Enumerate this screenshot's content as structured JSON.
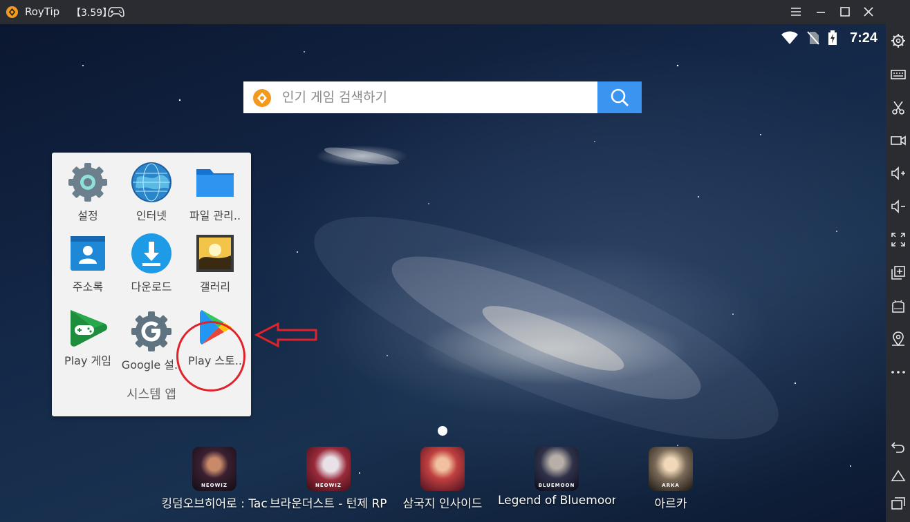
{
  "window": {
    "title": "RoyTip",
    "version": "【3.59】",
    "buttons": [
      "menu-icon",
      "minimize-icon",
      "maximize-icon",
      "close-icon",
      "collapse-icon"
    ]
  },
  "statusbar": {
    "time": "7:24",
    "icons": [
      "wifi-icon",
      "no-sim-icon",
      "battery-charging-icon"
    ]
  },
  "search": {
    "placeholder": "인기 게임 검색하기"
  },
  "folder": {
    "title": "시스템 앱",
    "apps": [
      {
        "label": "설정",
        "icon": "settings-gear-icon"
      },
      {
        "label": "인터넷",
        "icon": "globe-icon"
      },
      {
        "label": "파일 관리..",
        "icon": "folder-icon"
      },
      {
        "label": "주소록",
        "icon": "contacts-icon"
      },
      {
        "label": "다운로드",
        "icon": "download-icon"
      },
      {
        "label": "갤러리",
        "icon": "gallery-icon"
      },
      {
        "label": "Play 게임",
        "icon": "play-games-icon"
      },
      {
        "label": "Google 설..",
        "icon": "google-settings-icon"
      },
      {
        "label": "Play 스토..",
        "icon": "play-store-icon"
      }
    ]
  },
  "dock": [
    {
      "label": "킹덤오브히어로 : Tac",
      "badge": "NEOWIZ"
    },
    {
      "label": "브라운더스트 - 턴제 RPG",
      "badge": "NEOWIZ"
    },
    {
      "label": "삼국지 인사이드",
      "badge": ""
    },
    {
      "label": "Legend of Bluemoon",
      "badge": "BLUEMOON"
    },
    {
      "label": "아르카",
      "badge": "ARKA"
    }
  ],
  "toolbar": [
    "settings-icon",
    "keyboard-icon",
    "scissors-icon",
    "video-record-icon",
    "volume-up-icon",
    "volume-down-icon",
    "fullscreen-icon",
    "multi-instance-icon",
    "apk-install-icon",
    "location-icon",
    "more-icon",
    "back-icon",
    "home-icon",
    "recent-apps-icon"
  ],
  "colors": {
    "accent": "#3b95f0",
    "annotation": "#e0222a",
    "chrome": "#2b2c32"
  }
}
